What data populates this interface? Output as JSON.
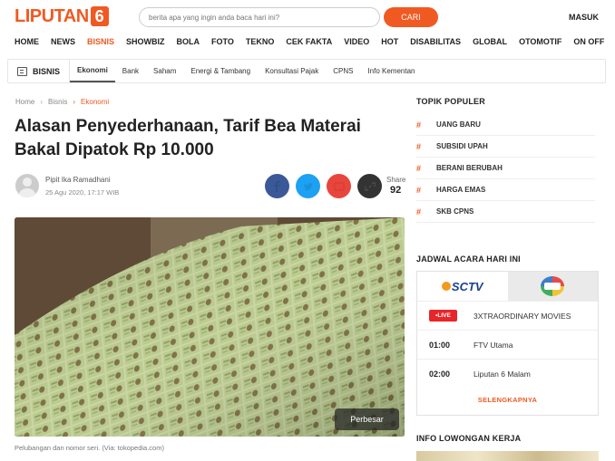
{
  "header": {
    "logo_text": "LIPUTAN",
    "logo_number": "6",
    "search_placeholder": "berita apa yang ingin anda baca hari ini?",
    "search_button": "CARI",
    "login": "MASUK"
  },
  "main_nav": [
    "HOME",
    "NEWS",
    "BISNIS",
    "SHOWBIZ",
    "BOLA",
    "FOTO",
    "TEKNO",
    "CEK FAKTA",
    "VIDEO",
    "HOT",
    "DISABILITAS",
    "GLOBAL",
    "OTOMOTIF",
    "ON OFF"
  ],
  "main_nav_active": "BISNIS",
  "sub_nav": {
    "section": "BISNIS",
    "items": [
      "Ekonomi",
      "Bank",
      "Saham",
      "Energi & Tambang",
      "Konsultasi Pajak",
      "CPNS",
      "Info Kementan"
    ],
    "active": "Ekonomi"
  },
  "breadcrumb": [
    "Home",
    "Bisnis",
    "Ekonomi"
  ],
  "article": {
    "title": "Alasan Penyederhanaan, Tarif Bea Materai Bakal Dipatok Rp 10.000",
    "author": "Pipit Ika Ramadhani",
    "date": "25 Agu 2020, 17:17 WIB",
    "share_label": "Share",
    "share_count": "92",
    "share_colors": [
      "#3b5998",
      "#1da1f2",
      "#e8453c",
      "#333333"
    ],
    "enlarge_button": "Perbesar",
    "caption": "Pelubangan dan nomor seri. (Via: tokopedia.com)"
  },
  "sidebar": {
    "popular_title": "TOPIK POPULER",
    "popular_topics": [
      "UANG BARU",
      "SUBSIDI UPAH",
      "BERANI BERUBAH",
      "HARGA EMAS",
      "SKB CPNS"
    ],
    "schedule_title": "JADWAL ACARA HARI INI",
    "channels": [
      "SCTV",
      "Indosiar"
    ],
    "schedule": [
      {
        "time": "LIVE",
        "show": "3XTRAORDINARY MOVIES"
      },
      {
        "time": "01:00",
        "show": "FTV Utama"
      },
      {
        "time": "02:00",
        "show": "Liputan 6 Malam"
      }
    ],
    "schedule_more": "SELENGKAPNYA",
    "jobs_title": "INFO LOWONGAN KERJA"
  },
  "colors": {
    "brand": "#f05a22",
    "live": "#e8252a"
  }
}
